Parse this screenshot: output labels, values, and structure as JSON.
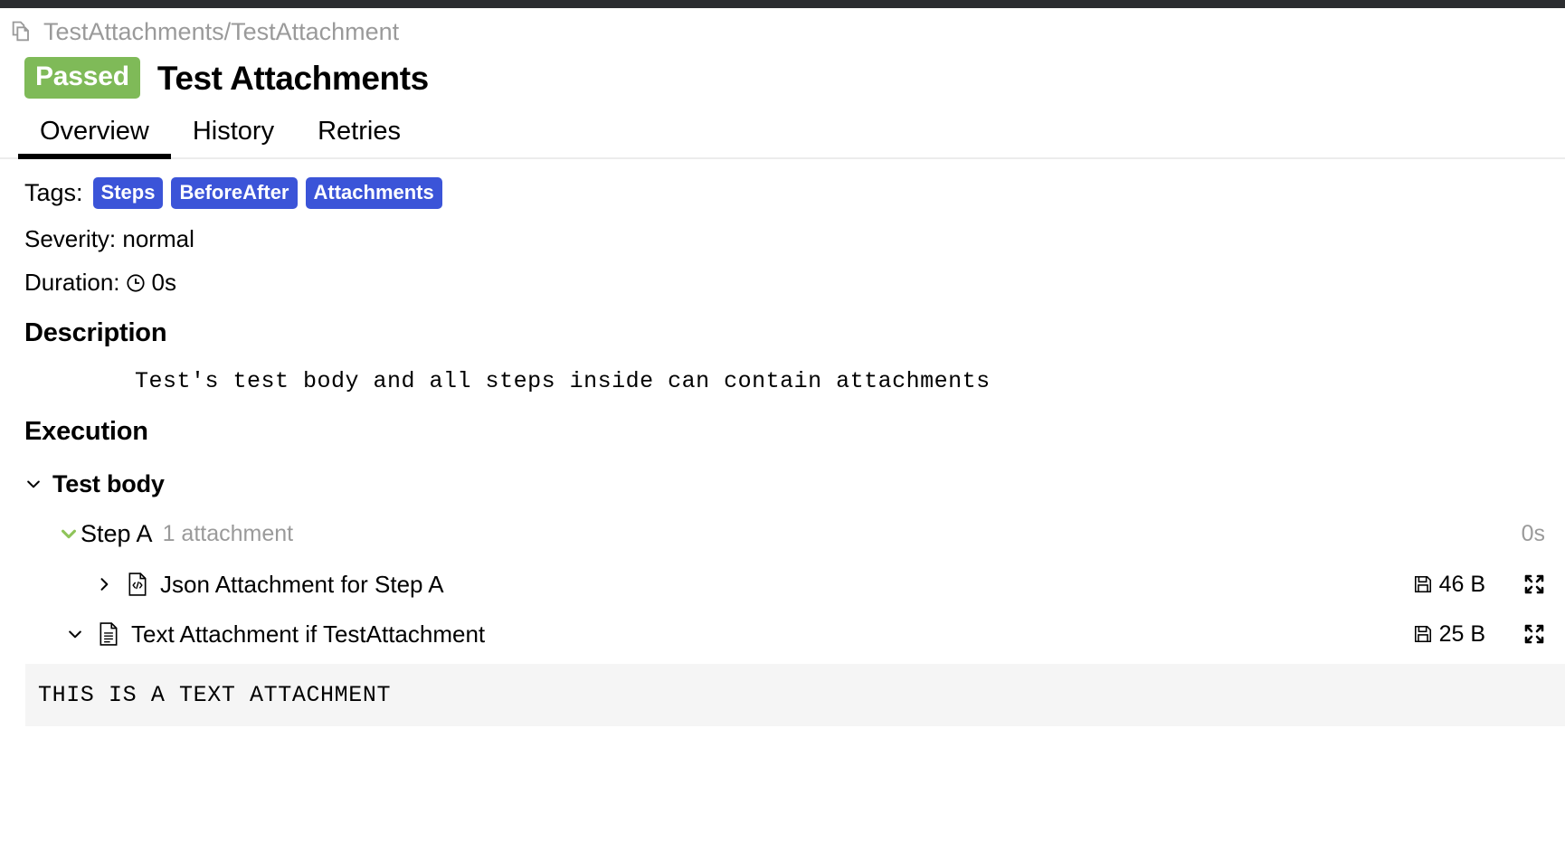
{
  "topbar": {
    "color": "#2b2d30"
  },
  "breadcrumb": {
    "icon": "copy-documents-icon",
    "path": "TestAttachments/TestAttachment"
  },
  "header": {
    "status": "Passed",
    "status_color": "#7fba58",
    "title": "Test Attachments"
  },
  "tabs": [
    {
      "label": "Overview",
      "active": true
    },
    {
      "label": "History",
      "active": false
    },
    {
      "label": "Retries",
      "active": false
    }
  ],
  "meta": {
    "tags_label": "Tags:",
    "tags": [
      "Steps",
      "BeforeAfter",
      "Attachments"
    ],
    "tag_color": "#3b54d8",
    "severity": "Severity: normal",
    "duration_label": "Duration:",
    "duration_icon": "clock-icon",
    "duration_value": "0s"
  },
  "description": {
    "heading": "Description",
    "body": "Test's test body and all steps inside can contain attachments"
  },
  "execution": {
    "heading": "Execution",
    "test_body": {
      "label": "Test body",
      "chevron": "chevron-down-icon",
      "expanded": true
    },
    "steps": [
      {
        "label": "Step A",
        "sub": "1 attachment",
        "duration": "0s",
        "chevron": "chevron-down-green-icon",
        "status_color": "#8fc45a",
        "attachments": [
          {
            "label": "Json Attachment for Step A",
            "chevron": "chevron-right-icon",
            "file_icon": "json-file-icon",
            "save_icon": "save-icon",
            "size": "46 B",
            "expand_icon": "expand-icon",
            "expanded": false
          }
        ]
      }
    ],
    "body_attachments": [
      {
        "label": "Text Attachment if TestAttachment",
        "chevron": "chevron-down-icon",
        "file_icon": "text-file-icon",
        "save_icon": "save-icon",
        "size": "25 B",
        "expand_icon": "expand-icon",
        "expanded": true,
        "content": "THIS IS A TEXT ATTACHMENT"
      }
    ]
  }
}
